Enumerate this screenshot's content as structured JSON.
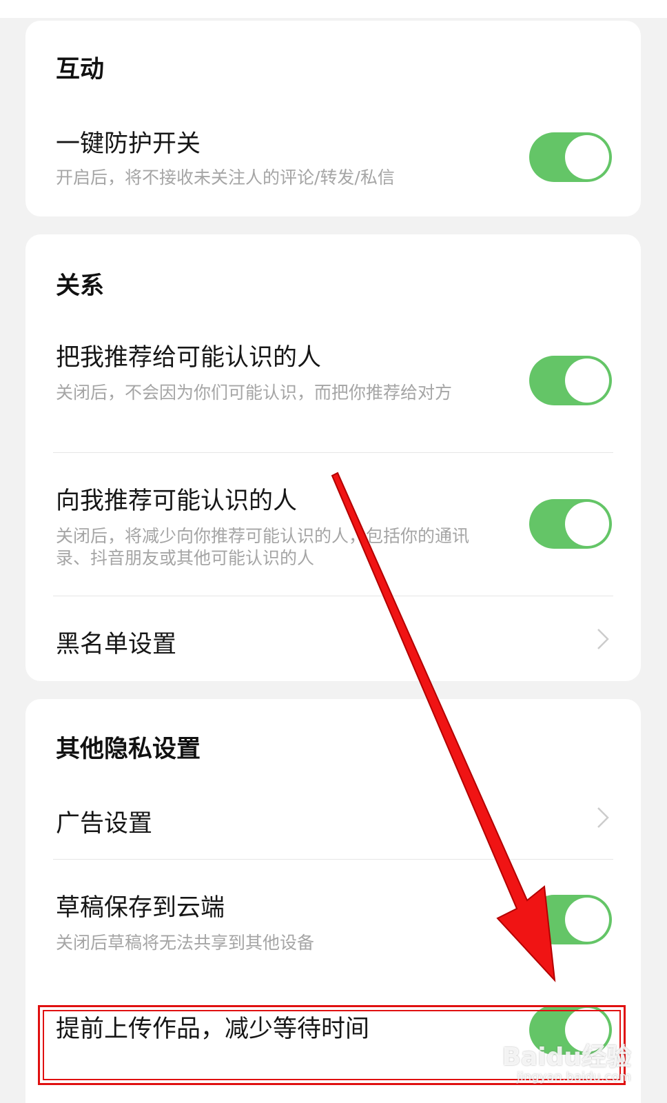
{
  "sections": {
    "interaction": {
      "title": "互动",
      "items": [
        {
          "title": "一键防护开关",
          "desc": "开启后，将不接收未关注人的评论/转发/私信",
          "on": true
        }
      ]
    },
    "relationship": {
      "title": "关系",
      "items": [
        {
          "title": "把我推荐给可能认识的人",
          "desc": "关闭后，不会因为你们可能认识，而把你推荐给对方",
          "on": true
        },
        {
          "title": "向我推荐可能认识的人",
          "desc": "关闭后，将减少向你推荐可能认识的人，包括你的通讯录、抖音朋友或其他可能认识的人",
          "on": true
        },
        {
          "title": "黑名单设置"
        }
      ]
    },
    "other": {
      "title": "其他隐私设置",
      "items": [
        {
          "title": "广告设置"
        },
        {
          "title": "草稿保存到云端",
          "desc": "关闭后草稿将无法共享到其他设备",
          "on": true
        },
        {
          "title": "提前上传作品，减少等待时间",
          "on": true
        }
      ]
    }
  },
  "colors": {
    "toggle_on": "#64c567",
    "annotation": "#e01010"
  },
  "icons": {
    "chevron": "chevron-right-icon"
  },
  "watermark": {
    "logo": "Baidu经验",
    "url": "jingyan.baidu.com"
  }
}
